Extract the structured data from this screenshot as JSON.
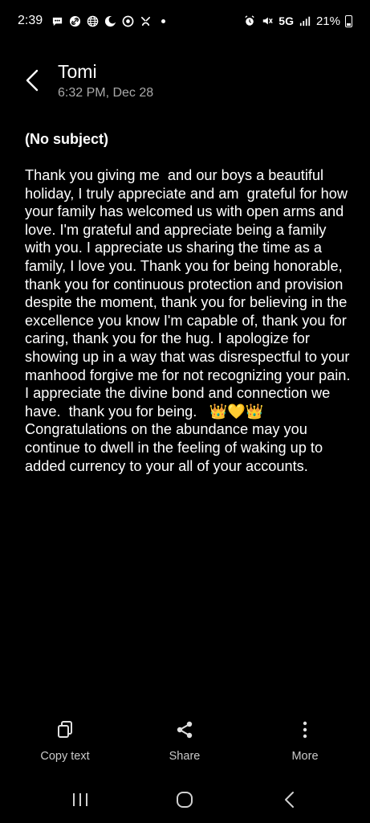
{
  "status_bar": {
    "time": "2:39",
    "network": "5G",
    "battery": "21%",
    "left_icons": [
      "chat-bubble-icon",
      "link-icon",
      "globe-icon",
      "moon-icon",
      "vpn-icon",
      "shortcut-icon"
    ],
    "right_icons": [
      "alarm-icon",
      "mute-icon",
      "signal-icon",
      "battery-icon"
    ]
  },
  "header": {
    "contact_name": "Tomi",
    "date": "6:32 PM, Dec 28"
  },
  "message": {
    "subject": "(No subject)",
    "body": "Thank you giving me  and our boys a beautiful holiday, I truly appreciate and am  grateful for how your family has welcomed us with open arms and love. I'm grateful and appreciate being a family with you. I appreciate us sharing the time as a family, I love you. Thank you for being honorable, thank you for continuous protection and provision despite the moment, thank you for believing in the excellence you know I'm capable of, thank you for caring, thank you for the hug. I apologize for showing up in a way that was disrespectful to your manhood forgive me for not recognizing your pain. I appreciate the divine bond and connection we have.  thank you for being.   👑💛👑\nCongratulations on the abundance may you continue to dwell in the feeling of waking up to added currency to your all of your accounts."
  },
  "actions": {
    "copy_label": "Copy text",
    "share_label": "Share",
    "more_label": "More"
  },
  "colors": {
    "background": "#000000",
    "text": "#ffffff",
    "secondary_text": "#a9a9a9"
  }
}
